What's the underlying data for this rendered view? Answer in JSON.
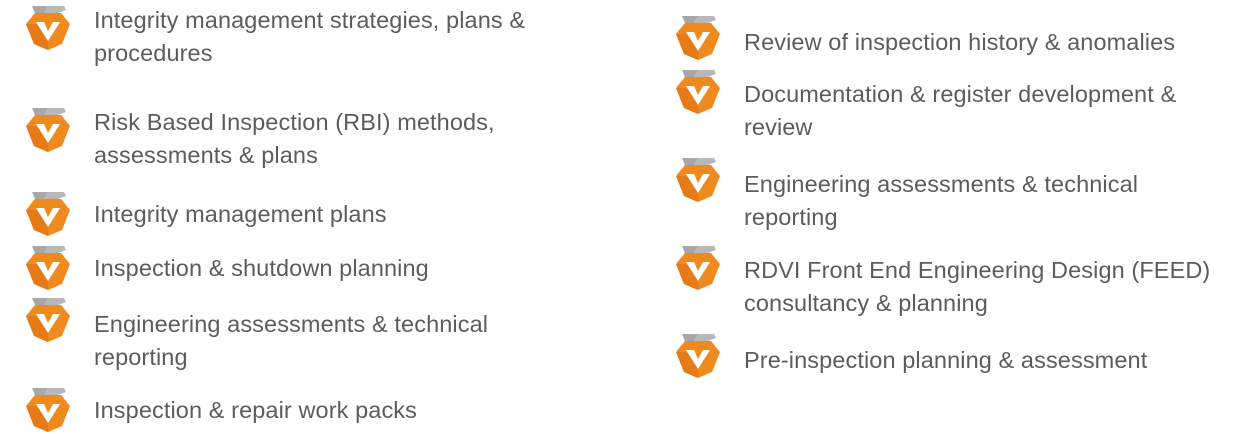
{
  "colors": {
    "accent": "#f08a1c",
    "accent_dark": "#e0761a",
    "gray": "#a8a8a8",
    "text": "#5c5c5c"
  },
  "icon": "orange-chevron-check-logo-icon",
  "left_column": [
    {
      "label": "Integrity management strategies, plans & procedures"
    },
    {
      "label": "Risk Based Inspection (RBI) methods, assessments & plans"
    },
    {
      "label": "Integrity management plans"
    },
    {
      "label": "Inspection & shutdown planning"
    },
    {
      "label": "Engineering assessments & technical reporting"
    },
    {
      "label": "Inspection & repair work packs"
    }
  ],
  "right_column": [
    {
      "label": "Review of inspection history & anomalies"
    },
    {
      "label": "Documentation & register development & review"
    },
    {
      "label": "Engineering assessments & technical reporting"
    },
    {
      "label": "RDVI Front End Engineering Design (FEED) consultancy & planning"
    },
    {
      "label": "Pre-inspection planning & assessment"
    }
  ]
}
